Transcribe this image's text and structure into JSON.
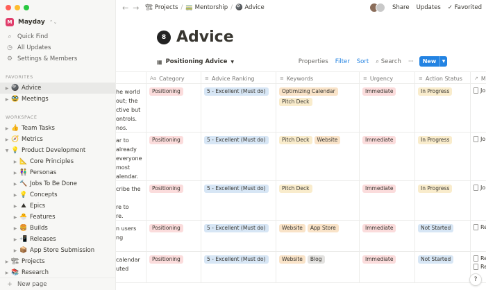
{
  "workspace": {
    "name": "Mayday",
    "logo_letter": "M"
  },
  "sidebar": {
    "nav": [
      {
        "label": "Quick Find",
        "icon": "search-icon",
        "glyph": "⌕"
      },
      {
        "label": "All Updates",
        "icon": "clock-icon",
        "glyph": "◷"
      },
      {
        "label": "Settings & Members",
        "icon": "gear-icon",
        "glyph": "⚙"
      }
    ],
    "favorites_label": "FAVORITES",
    "favorites": [
      {
        "label": "Advice",
        "emoji": "🎱",
        "active": true
      },
      {
        "label": "Meetings",
        "emoji": "🥸",
        "active": false
      }
    ],
    "workspace_label": "WORKSPACE",
    "workspace_items": [
      {
        "label": "Team Tasks",
        "emoji": "👍",
        "level": 0,
        "open": false
      },
      {
        "label": "Metrics",
        "emoji": "🧭",
        "level": 0,
        "open": false
      },
      {
        "label": "Product Development",
        "emoji": "💡",
        "level": 0,
        "open": true
      },
      {
        "label": "Core Principles",
        "emoji": "📐",
        "level": 1,
        "open": false
      },
      {
        "label": "Personas",
        "emoji": "👫",
        "level": 1,
        "open": false
      },
      {
        "label": "Jobs To Be Done",
        "emoji": "🔨",
        "level": 1,
        "open": false
      },
      {
        "label": "Concepts",
        "emoji": "💡",
        "level": 1,
        "open": false
      },
      {
        "label": "Epics",
        "emoji": "⛰",
        "level": 1,
        "open": false
      },
      {
        "label": "Features",
        "emoji": "🐣",
        "level": 1,
        "open": false
      },
      {
        "label": "Builds",
        "emoji": "🍔",
        "level": 1,
        "open": false
      },
      {
        "label": "Releases",
        "emoji": "📲",
        "level": 1,
        "open": false
      },
      {
        "label": "App Store Submission",
        "emoji": "📦",
        "level": 1,
        "open": false
      },
      {
        "label": "Projects",
        "emoji": "🏗",
        "level": 0,
        "open": false
      },
      {
        "label": "Research",
        "emoji": "📚",
        "level": 0,
        "open": false
      }
    ],
    "new_page": "New page"
  },
  "topbar": {
    "breadcrumbs": [
      {
        "label": "Projects",
        "emoji": "🏗"
      },
      {
        "label": "Mentorship",
        "emoji": "🚃"
      },
      {
        "label": "Advice",
        "emoji": "🎱"
      }
    ],
    "share": "Share",
    "updates": "Updates",
    "favorited": "Favorited"
  },
  "page": {
    "title": "Advice",
    "emoji": "🎱"
  },
  "view": {
    "name": "Positioning Advice",
    "properties": "Properties",
    "filter": "Filter",
    "sort": "Sort",
    "search": "Search",
    "more": "···",
    "new": "New"
  },
  "table": {
    "columns": [
      {
        "label": "Category",
        "icon": "Aa"
      },
      {
        "label": "Advice Ranking",
        "icon": "≡"
      },
      {
        "label": "Keywords",
        "icon": "≡"
      },
      {
        "label": "Urgency",
        "icon": "≡"
      },
      {
        "label": "Action Status",
        "icon": "≡"
      },
      {
        "label": "M",
        "icon": "↗"
      }
    ],
    "rows": [
      {
        "text": [
          "he world",
          "out; the",
          "ctive but",
          "ontrols.",
          "nos."
        ],
        "category": "Positioning",
        "ranking": "5 - Excellent (Must do)",
        "keywords": [
          {
            "label": "Optimizing Calendar",
            "color": "orange"
          },
          {
            "label": "Pitch Deck",
            "color": "yellow"
          }
        ],
        "urgency": "Immediate",
        "status": {
          "label": "In Progress",
          "color": "yellow"
        },
        "mentions": [
          "Jo"
        ]
      },
      {
        "text": [
          "ar to",
          "already",
          "everyone",
          "most",
          "alendar."
        ],
        "category": "Positioning",
        "ranking": "5 - Excellent (Must do)",
        "keywords": [
          {
            "label": "Pitch Deck",
            "color": "yellow"
          },
          {
            "label": "Website",
            "color": "orange"
          }
        ],
        "urgency": "Immediate",
        "status": {
          "label": "In Progress",
          "color": "yellow"
        },
        "mentions": [
          "Jo"
        ]
      },
      {
        "text": [
          "cribe the",
          "",
          "re to",
          "re."
        ],
        "category": "Positioning",
        "ranking": "5 - Excellent (Must do)",
        "keywords": [
          {
            "label": "Pitch Deck",
            "color": "yellow"
          }
        ],
        "urgency": "Immediate",
        "status": {
          "label": "In Progress",
          "color": "yellow"
        },
        "mentions": [
          "Jo"
        ]
      },
      {
        "text": [
          "n users",
          "ng"
        ],
        "category": "Positioning",
        "ranking": "5 - Excellent (Must do)",
        "keywords": [
          {
            "label": "Website",
            "color": "orange"
          },
          {
            "label": "App Store",
            "color": "orange"
          }
        ],
        "urgency": "Immediate",
        "status": {
          "label": "Not Started",
          "color": "blue"
        },
        "mentions": [
          "Re"
        ]
      },
      {
        "text": [
          "calendar",
          "uted"
        ],
        "category": "Positioning",
        "ranking": "5 - Excellent (Must do)",
        "keywords": [
          {
            "label": "Website",
            "color": "orange"
          },
          {
            "label": "Blog",
            "color": "gray"
          }
        ],
        "urgency": "Immediate",
        "status": {
          "label": "Not Started",
          "color": "blue"
        },
        "mentions": [
          "Re",
          "Re"
        ]
      }
    ]
  },
  "help": "?",
  "colors": {
    "accent": "#2383e2",
    "sidebar_bg": "#f7f7f5",
    "red_tag": "#fbdcdc",
    "blue_tag": "#d7e6f5",
    "orange_tag": "#f9e3c8",
    "gray_tag": "#e3e2e0"
  }
}
